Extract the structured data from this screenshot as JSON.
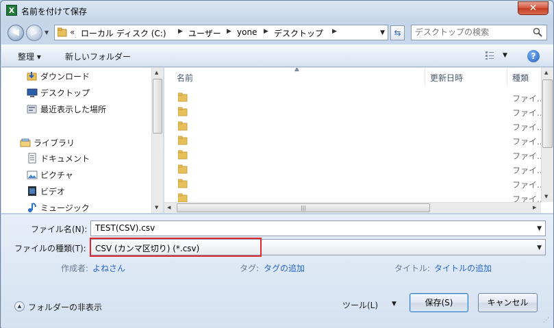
{
  "window": {
    "title": "名前を付けて保存",
    "app_icon_letter": "X",
    "close_glyph": "✕"
  },
  "address_bar": {
    "overflow": "«",
    "breadcrumbs": [
      "ローカル ディスク (C:)",
      "ユーザー",
      "yone",
      "デスクトップ"
    ],
    "search_placeholder": "デスクトップの検索"
  },
  "toolbar": {
    "organize": "整理 ▾",
    "new_folder": "新しいフォルダー",
    "help": "?"
  },
  "nav_pane": {
    "items": [
      {
        "label": "ダウンロード",
        "icon": "download-folder-icon"
      },
      {
        "label": "デスクトップ",
        "icon": "desktop-icon"
      },
      {
        "label": "最近表示した場所",
        "icon": "recent-places-icon"
      },
      {
        "label": "ライブラリ",
        "icon": "libraries-icon"
      },
      {
        "label": "ドキュメント",
        "icon": "documents-icon"
      },
      {
        "label": "ピクチャ",
        "icon": "pictures-icon"
      },
      {
        "label": "ビデオ",
        "icon": "videos-icon"
      },
      {
        "label": "ミュージック",
        "icon": "music-icon"
      }
    ]
  },
  "file_list": {
    "columns": {
      "name": "名前",
      "date": "更新日時",
      "type": "種類"
    },
    "rows": [
      {
        "type": "ファイ..."
      },
      {
        "type": "ファイ..."
      },
      {
        "type": "ファイ..."
      },
      {
        "type": "ファイ..."
      },
      {
        "type": "ファイ..."
      },
      {
        "type": "ファイ..."
      },
      {
        "type": "ファイ..."
      },
      {
        "type": "ファイ..."
      }
    ]
  },
  "form": {
    "filename_label": "ファイル名(N):",
    "filename_value": "TEST(CSV).csv",
    "filetype_label": "ファイルの種類(T):",
    "filetype_value": "CSV (カンマ区切り) (*.csv)",
    "author_label": "作成者:",
    "author_value": "よねさん",
    "tags_label": "タグ:",
    "tags_value": "タグの追加",
    "title_label": "タイトル:",
    "title_value": "タイトルの追加"
  },
  "footer": {
    "hide_folders": "フォルダーの非表示",
    "tools": "ツール(L)",
    "save": "保存(S)",
    "cancel": "キャンセル"
  },
  "colors": {
    "highlight_outline": "#e0252b",
    "link": "#2366c9",
    "folder": "#e8c05a"
  }
}
